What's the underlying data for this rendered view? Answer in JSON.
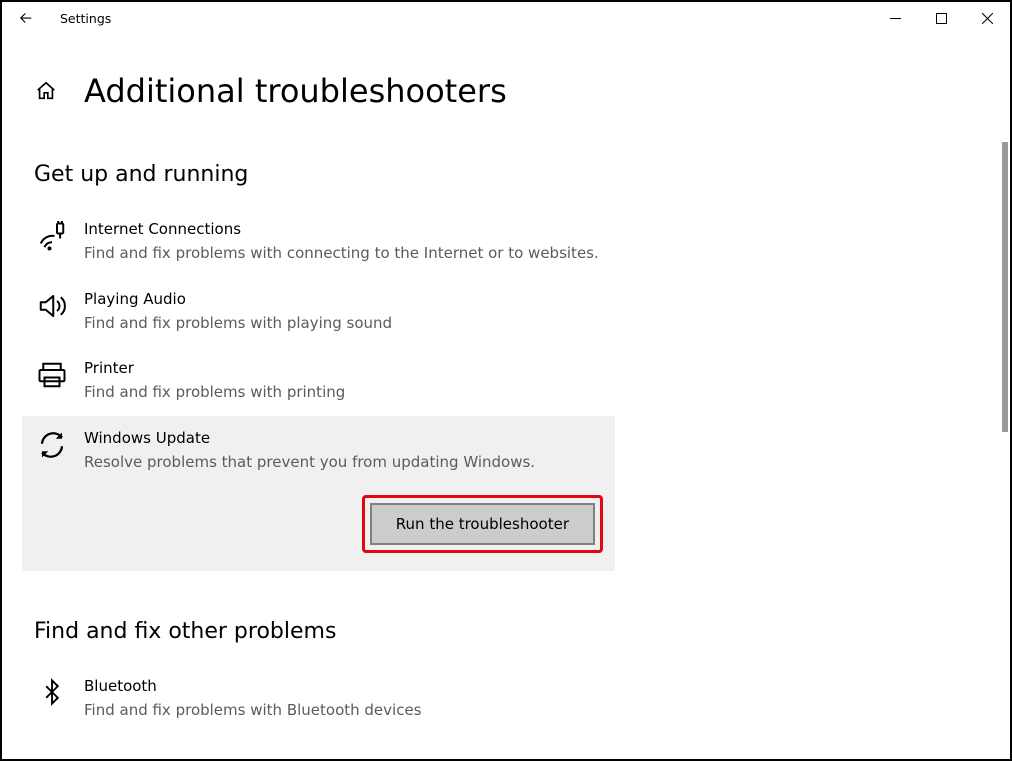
{
  "window": {
    "title": "Settings"
  },
  "page": {
    "title": "Additional troubleshooters"
  },
  "section1": {
    "title": "Get up and running",
    "items": [
      {
        "name": "Internet Connections",
        "desc": "Find and fix problems with connecting to the Internet or to websites."
      },
      {
        "name": "Playing Audio",
        "desc": "Find and fix problems with playing sound"
      },
      {
        "name": "Printer",
        "desc": "Find and fix problems with printing"
      },
      {
        "name": "Windows Update",
        "desc": "Resolve problems that prevent you from updating Windows.",
        "run_label": "Run the troubleshooter"
      }
    ]
  },
  "section2": {
    "title": "Find and fix other problems",
    "items": [
      {
        "name": "Bluetooth",
        "desc": "Find and fix problems with Bluetooth devices"
      }
    ]
  }
}
